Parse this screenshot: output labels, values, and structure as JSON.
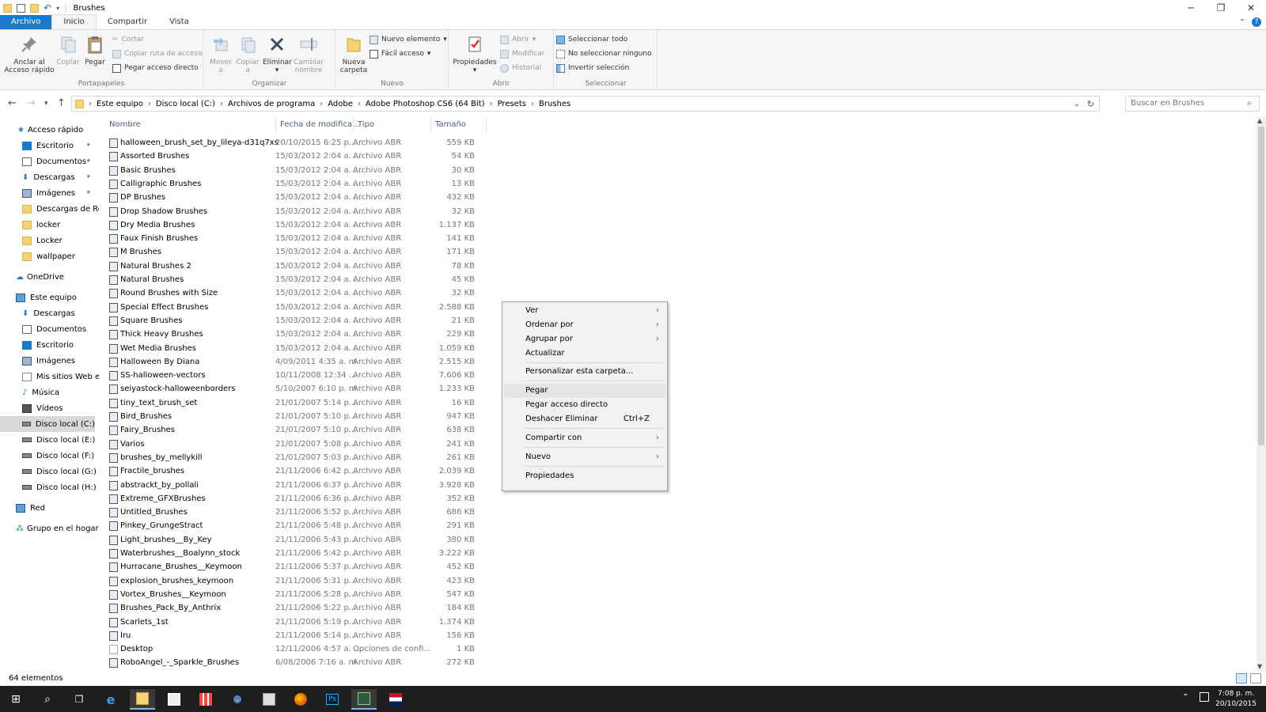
{
  "window": {
    "title": "Brushes"
  },
  "ribbon_tabs": [
    "Archivo",
    "Inicio",
    "Compartir",
    "Vista"
  ],
  "ribbon": {
    "portapapeles": {
      "label": "Portapapeles",
      "pin_label_1": "Anclar al",
      "pin_label_2": "Acceso rápido",
      "copy": "Copiar",
      "paste": "Pegar",
      "cut": "Cortar",
      "copy_path": "Copiar ruta de acceso",
      "paste_shortcut": "Pegar acceso directo"
    },
    "organizar": {
      "label": "Organizar",
      "move_1": "Mover",
      "move_2": "a",
      "copy_1": "Copiar",
      "copy_2": "a",
      "delete": "Eliminar",
      "rename_1": "Cambiar",
      "rename_2": "nombre"
    },
    "nuevo": {
      "label": "Nuevo",
      "new_folder_1": "Nueva",
      "new_folder_2": "carpeta",
      "new_item": "Nuevo elemento",
      "easy_access": "Fácil acceso"
    },
    "abrir": {
      "label": "Abrir",
      "properties": "Propiedades",
      "open": "Abrir",
      "edit": "Modificar",
      "history": "Historial"
    },
    "seleccionar": {
      "label": "Seleccionar",
      "select_all": "Seleccionar todo",
      "select_none": "No seleccionar ninguno",
      "invert": "Invertir selección"
    }
  },
  "address": {
    "crumbs": [
      "Este equipo",
      "Disco local (C:)",
      "Archivos de programa",
      "Adobe",
      "Adobe Photoshop CS6 (64 Bit)",
      "Presets",
      "Brushes"
    ],
    "search_placeholder": "Buscar en Brushes"
  },
  "nav": {
    "quick_access": "Acceso rápido",
    "items": [
      "Escritorio",
      "Documentos",
      "Descargas",
      "Imágenes",
      "Descargas de Rea",
      "locker",
      "Locker",
      "wallpaper"
    ],
    "onedrive": "OneDrive",
    "this_pc": "Este equipo",
    "pc_items": [
      "Descargas",
      "Documentos",
      "Escritorio",
      "Imágenes",
      "Mis sitios Web en",
      "Música",
      "Vídeos",
      "Disco local (C:)",
      "Disco local (E:)",
      "Disco local (F:)",
      "Disco local (G:)",
      "Disco local (H:)"
    ],
    "network": "Red",
    "homegroup": "Grupo en el hogar"
  },
  "columns": {
    "name": "Nombre",
    "date": "Fecha de modifica...",
    "type": "Tipo",
    "size": "Tamaño"
  },
  "files": [
    {
      "name": "halloween_brush_set_by_lileya-d31q7xs",
      "date": "20/10/2015 6:25 p....",
      "type": "Archivo ABR",
      "size": "559 KB"
    },
    {
      "name": "Assorted Brushes",
      "date": "15/03/2012 2:04 a. ...",
      "type": "Archivo ABR",
      "size": "54 KB"
    },
    {
      "name": "Basic Brushes",
      "date": "15/03/2012 2:04 a. ...",
      "type": "Archivo ABR",
      "size": "30 KB"
    },
    {
      "name": "Calligraphic Brushes",
      "date": "15/03/2012 2:04 a. ...",
      "type": "Archivo ABR",
      "size": "13 KB"
    },
    {
      "name": "DP Brushes",
      "date": "15/03/2012 2:04 a. ...",
      "type": "Archivo ABR",
      "size": "432 KB"
    },
    {
      "name": "Drop Shadow Brushes",
      "date": "15/03/2012 2:04 a. ...",
      "type": "Archivo ABR",
      "size": "32 KB"
    },
    {
      "name": "Dry Media Brushes",
      "date": "15/03/2012 2:04 a. ...",
      "type": "Archivo ABR",
      "size": "1.137 KB"
    },
    {
      "name": "Faux Finish Brushes",
      "date": "15/03/2012 2:04 a. ...",
      "type": "Archivo ABR",
      "size": "141 KB"
    },
    {
      "name": "M Brushes",
      "date": "15/03/2012 2:04 a. ...",
      "type": "Archivo ABR",
      "size": "171 KB"
    },
    {
      "name": "Natural Brushes 2",
      "date": "15/03/2012 2:04 a. ...",
      "type": "Archivo ABR",
      "size": "78 KB"
    },
    {
      "name": "Natural Brushes",
      "date": "15/03/2012 2:04 a. ...",
      "type": "Archivo ABR",
      "size": "45 KB"
    },
    {
      "name": "Round Brushes with Size",
      "date": "15/03/2012 2:04 a. ...",
      "type": "Archivo ABR",
      "size": "32 KB"
    },
    {
      "name": "Special Effect Brushes",
      "date": "15/03/2012 2:04 a. ...",
      "type": "Archivo ABR",
      "size": "2.588 KB"
    },
    {
      "name": "Square Brushes",
      "date": "15/03/2012 2:04 a. ...",
      "type": "Archivo ABR",
      "size": "21 KB"
    },
    {
      "name": "Thick Heavy Brushes",
      "date": "15/03/2012 2:04 a. ...",
      "type": "Archivo ABR",
      "size": "229 KB"
    },
    {
      "name": "Wet Media Brushes",
      "date": "15/03/2012 2:04 a. ...",
      "type": "Archivo ABR",
      "size": "1.059 KB"
    },
    {
      "name": "Halloween By Diana",
      "date": "4/09/2011 4:35 a. m.",
      "type": "Archivo ABR",
      "size": "2.515 KB"
    },
    {
      "name": "SS-halloween-vectors",
      "date": "10/11/2008 12:34 ...",
      "type": "Archivo ABR",
      "size": "7.606 KB"
    },
    {
      "name": "seiyastock-halloweenborders",
      "date": "5/10/2007 6:10 p. m.",
      "type": "Archivo ABR",
      "size": "1.233 KB"
    },
    {
      "name": "tiny_text_brush_set",
      "date": "21/01/2007 5:14 p....",
      "type": "Archivo ABR",
      "size": "16 KB"
    },
    {
      "name": "Bird_Brushes",
      "date": "21/01/2007 5:10 p....",
      "type": "Archivo ABR",
      "size": "947 KB"
    },
    {
      "name": "Fairy_Brushes",
      "date": "21/01/2007 5:10 p....",
      "type": "Archivo ABR",
      "size": "638 KB"
    },
    {
      "name": "Varios",
      "date": "21/01/2007 5:08 p....",
      "type": "Archivo ABR",
      "size": "241 KB"
    },
    {
      "name": "brushes_by_mellykill",
      "date": "21/01/2007 5:03 p....",
      "type": "Archivo ABR",
      "size": "261 KB"
    },
    {
      "name": "Fractile_brushes",
      "date": "21/11/2006 6:42 p....",
      "type": "Archivo ABR",
      "size": "2.039 KB"
    },
    {
      "name": "abstrackt_by_pollali",
      "date": "21/11/2006 6:37 p....",
      "type": "Archivo ABR",
      "size": "3.928 KB"
    },
    {
      "name": "Extreme_GFXBrushes",
      "date": "21/11/2006 6:36 p....",
      "type": "Archivo ABR",
      "size": "352 KB"
    },
    {
      "name": "Untitled_Brushes",
      "date": "21/11/2006 5:52 p....",
      "type": "Archivo ABR",
      "size": "686 KB"
    },
    {
      "name": "Pinkey_GrungeStract",
      "date": "21/11/2006 5:48 p....",
      "type": "Archivo ABR",
      "size": "291 KB"
    },
    {
      "name": "Light_brushes__By_Key",
      "date": "21/11/2006 5:43 p....",
      "type": "Archivo ABR",
      "size": "380 KB"
    },
    {
      "name": "Waterbrushes__Boalynn_stock",
      "date": "21/11/2006 5:42 p....",
      "type": "Archivo ABR",
      "size": "3.222 KB"
    },
    {
      "name": "Hurracane_Brushes__Keymoon",
      "date": "21/11/2006 5:37 p....",
      "type": "Archivo ABR",
      "size": "452 KB"
    },
    {
      "name": "explosion_brushes_keymoon",
      "date": "21/11/2006 5:31 p....",
      "type": "Archivo ABR",
      "size": "423 KB"
    },
    {
      "name": "Vortex_Brushes__Keymoon",
      "date": "21/11/2006 5:28 p....",
      "type": "Archivo ABR",
      "size": "547 KB"
    },
    {
      "name": "Brushes_Pack_By_Anthrix",
      "date": "21/11/2006 5:22 p....",
      "type": "Archivo ABR",
      "size": "184 KB"
    },
    {
      "name": "Scarlets_1st",
      "date": "21/11/2006 5:19 p....",
      "type": "Archivo ABR",
      "size": "1.374 KB"
    },
    {
      "name": "Iru",
      "date": "21/11/2006 5:14 p....",
      "type": "Archivo ABR",
      "size": "156 KB"
    },
    {
      "name": "Desktop",
      "date": "12/11/2006 4:57 a. ...",
      "type": "Opciones de confi...",
      "size": "1 KB"
    },
    {
      "name": "RoboAngel_-_Sparkle_Brushes",
      "date": "6/08/2006 7:16 a. m.",
      "type": "Archivo ABR",
      "size": "272 KB"
    }
  ],
  "context_menu": {
    "view": "Ver",
    "sort": "Ordenar por",
    "group": "Agrupar por",
    "refresh": "Actualizar",
    "customize": "Personalizar esta carpeta...",
    "paste": "Pegar",
    "paste_shortcut": "Pegar acceso directo",
    "undo": "Deshacer Eliminar",
    "undo_shortcut": "Ctrl+Z",
    "share": "Compartir con",
    "new": "Nuevo",
    "properties": "Propiedades"
  },
  "status": {
    "count": "64 elementos"
  },
  "taskbar": {
    "time": "7:08 p. m.",
    "date": "20/10/2015"
  },
  "colors": {
    "accent": "#1979ca",
    "taskbar": "#1e1e1e",
    "folder": "#f3d372"
  }
}
